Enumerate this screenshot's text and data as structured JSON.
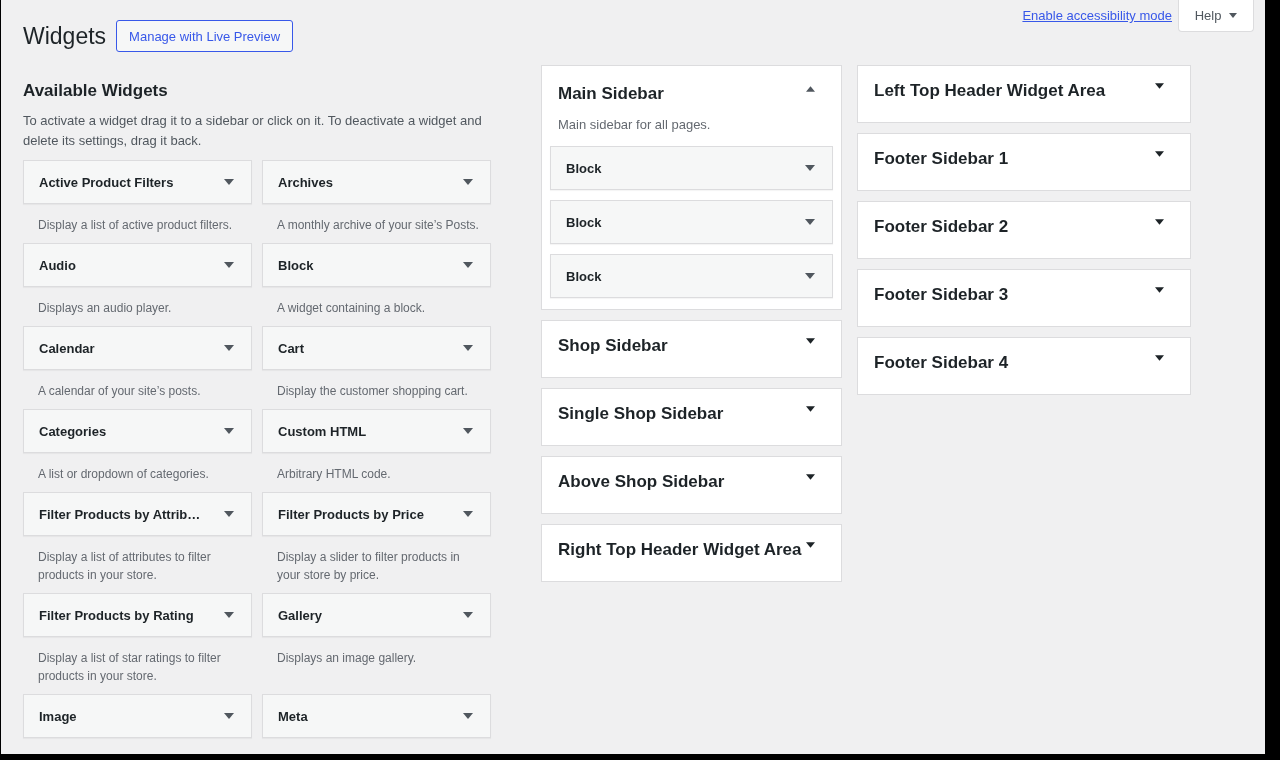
{
  "page_title": "Widgets",
  "live_preview_button": "Manage with Live Preview",
  "accessibility_link": "Enable accessibility mode",
  "help_button": "Help",
  "available_widgets": {
    "heading": "Available Widgets",
    "description": "To activate a widget drag it to a sidebar or click on it. To deactivate a widget and delete its settings, drag it back.",
    "widgets": [
      {
        "title": "Active Product Filters",
        "description": "Display a list of active product filters."
      },
      {
        "title": "Archives",
        "description": "A monthly archive of your site’s Posts."
      },
      {
        "title": "Audio",
        "description": "Displays an audio player."
      },
      {
        "title": "Block",
        "description": "A widget containing a block."
      },
      {
        "title": "Calendar",
        "description": "A calendar of your site’s posts."
      },
      {
        "title": "Cart",
        "description": "Display the customer shopping cart."
      },
      {
        "title": "Categories",
        "description": "A list or dropdown of categories."
      },
      {
        "title": "Custom HTML",
        "description": "Arbitrary HTML code."
      },
      {
        "title": "Filter Products by Attrib…",
        "description": "Display a list of attributes to filter products in your store."
      },
      {
        "title": "Filter Products by Price",
        "description": "Display a slider to filter products in your store by price."
      },
      {
        "title": "Filter Products by Rating",
        "description": "Display a list of star ratings to filter products in your store."
      },
      {
        "title": "Gallery",
        "description": "Displays an image gallery."
      },
      {
        "title": "Image"
      },
      {
        "title": "Meta"
      }
    ]
  },
  "sidebar_columns": [
    {
      "areas": [
        {
          "title": "Main Sidebar",
          "expanded": true,
          "description": "Main sidebar for all pages.",
          "widgets": [
            {
              "title": "Block"
            },
            {
              "title": "Block"
            },
            {
              "title": "Block"
            }
          ]
        },
        {
          "title": "Shop Sidebar",
          "expanded": false
        },
        {
          "title": "Single Shop Sidebar",
          "expanded": false
        },
        {
          "title": "Above Shop Sidebar",
          "expanded": false
        },
        {
          "title": "Right Top Header Widget Area",
          "expanded": false
        }
      ]
    },
    {
      "areas": [
        {
          "title": "Left Top Header Widget Area",
          "expanded": false
        },
        {
          "title": "Footer Sidebar 1",
          "expanded": false
        },
        {
          "title": "Footer Sidebar 2",
          "expanded": false
        },
        {
          "title": "Footer Sidebar 3",
          "expanded": false
        },
        {
          "title": "Footer Sidebar 4",
          "expanded": false
        }
      ]
    }
  ]
}
